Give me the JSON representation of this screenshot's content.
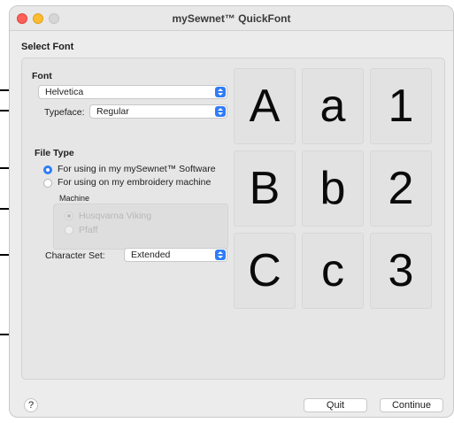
{
  "window": {
    "title": "mySewnet™ QuickFont"
  },
  "section_title": "Select Font",
  "font": {
    "heading": "Font",
    "font_value": "Helvetica",
    "typeface_label": "Typeface:",
    "typeface_value": "Regular"
  },
  "file_type": {
    "heading": "File Type",
    "options": [
      {
        "label": "For using in my mySewnet™ Software",
        "selected": true
      },
      {
        "label": "For using on my embroidery machine",
        "selected": false
      }
    ],
    "machine": {
      "heading": "Machine",
      "options": [
        {
          "label": "Husqvarna Viking",
          "selected": true,
          "enabled": false
        },
        {
          "label": "Pfaff",
          "selected": false,
          "enabled": false
        }
      ]
    }
  },
  "character_set": {
    "label": "Character Set:",
    "value": "Extended"
  },
  "preview": {
    "characters": [
      "A",
      "a",
      "1",
      "B",
      "b",
      "2",
      "C",
      "c",
      "3"
    ]
  },
  "footer": {
    "help_label": "?",
    "quit_label": "Quit",
    "continue_label": "Continue"
  },
  "colors": {
    "accent": "#2f7cf6",
    "traffic_red": "#fe5f57",
    "traffic_yellow": "#febc2e"
  },
  "icons": {
    "popup": "chevron-up-down-icon"
  }
}
